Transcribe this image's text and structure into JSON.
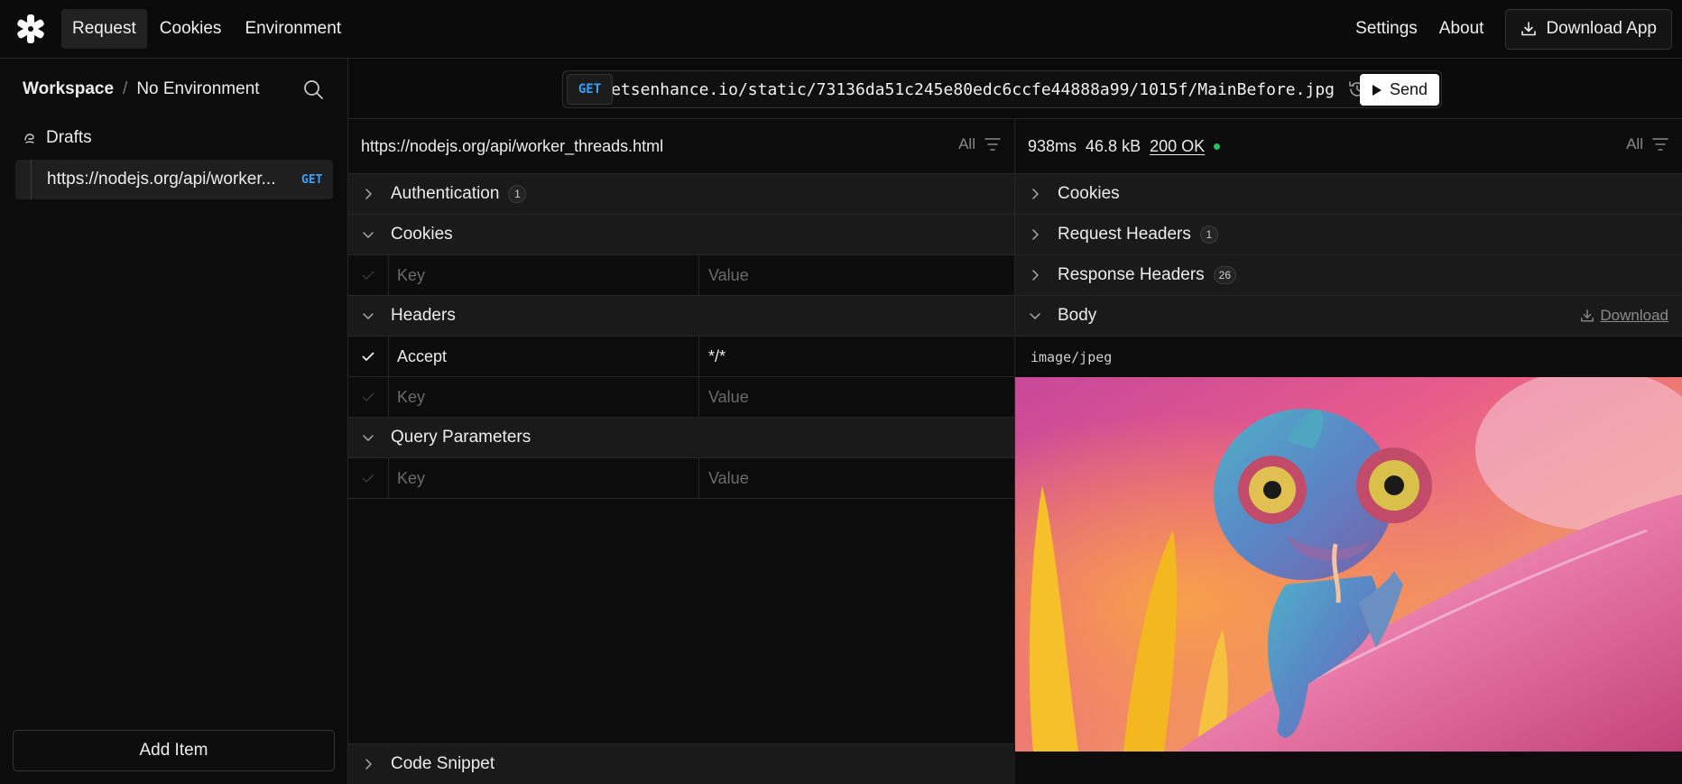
{
  "nav": {
    "tabs": [
      {
        "label": "Request"
      },
      {
        "label": "Cookies"
      },
      {
        "label": "Environment"
      }
    ],
    "settings": "Settings",
    "about": "About",
    "download_app": "Download App"
  },
  "sidebar": {
    "workspace": "Workspace",
    "separator": "/",
    "environment": "No Environment",
    "drafts_label": "Drafts",
    "draft_item": {
      "url": "https://nodejs.org/api/worker...",
      "method": "GET"
    },
    "add_item": "Add Item"
  },
  "urlbar": {
    "method": "GET",
    "url": "https://letsenhance.io/static/73136da51c245e80edc6ccfe44888a99/1015f/MainBefore.jpg",
    "send": "Send"
  },
  "request": {
    "title": "https://nodejs.org/api/worker_threads.html",
    "filter": "All",
    "sections": {
      "authentication": {
        "label": "Authentication",
        "count": "1"
      },
      "cookies": {
        "label": "Cookies"
      },
      "headers": {
        "label": "Headers"
      },
      "query": {
        "label": "Query Parameters"
      }
    },
    "placeholders": {
      "key": "Key",
      "value": "Value"
    },
    "headers": [
      {
        "key": "Accept",
        "value": "*/*"
      }
    ],
    "code_snippet": "Code Snippet"
  },
  "response": {
    "time": "938ms",
    "size": "46.8 kB",
    "status": "200 OK",
    "filter": "All",
    "sections": {
      "cookies": {
        "label": "Cookies"
      },
      "request_headers": {
        "label": "Request Headers",
        "count": "1"
      },
      "response_headers": {
        "label": "Response Headers",
        "count": "26"
      },
      "body": {
        "label": "Body"
      }
    },
    "download": "Download",
    "mime": "image/jpeg"
  },
  "colors": {
    "accent_get": "#3aa0ff",
    "status_dot": "#22c55e"
  }
}
